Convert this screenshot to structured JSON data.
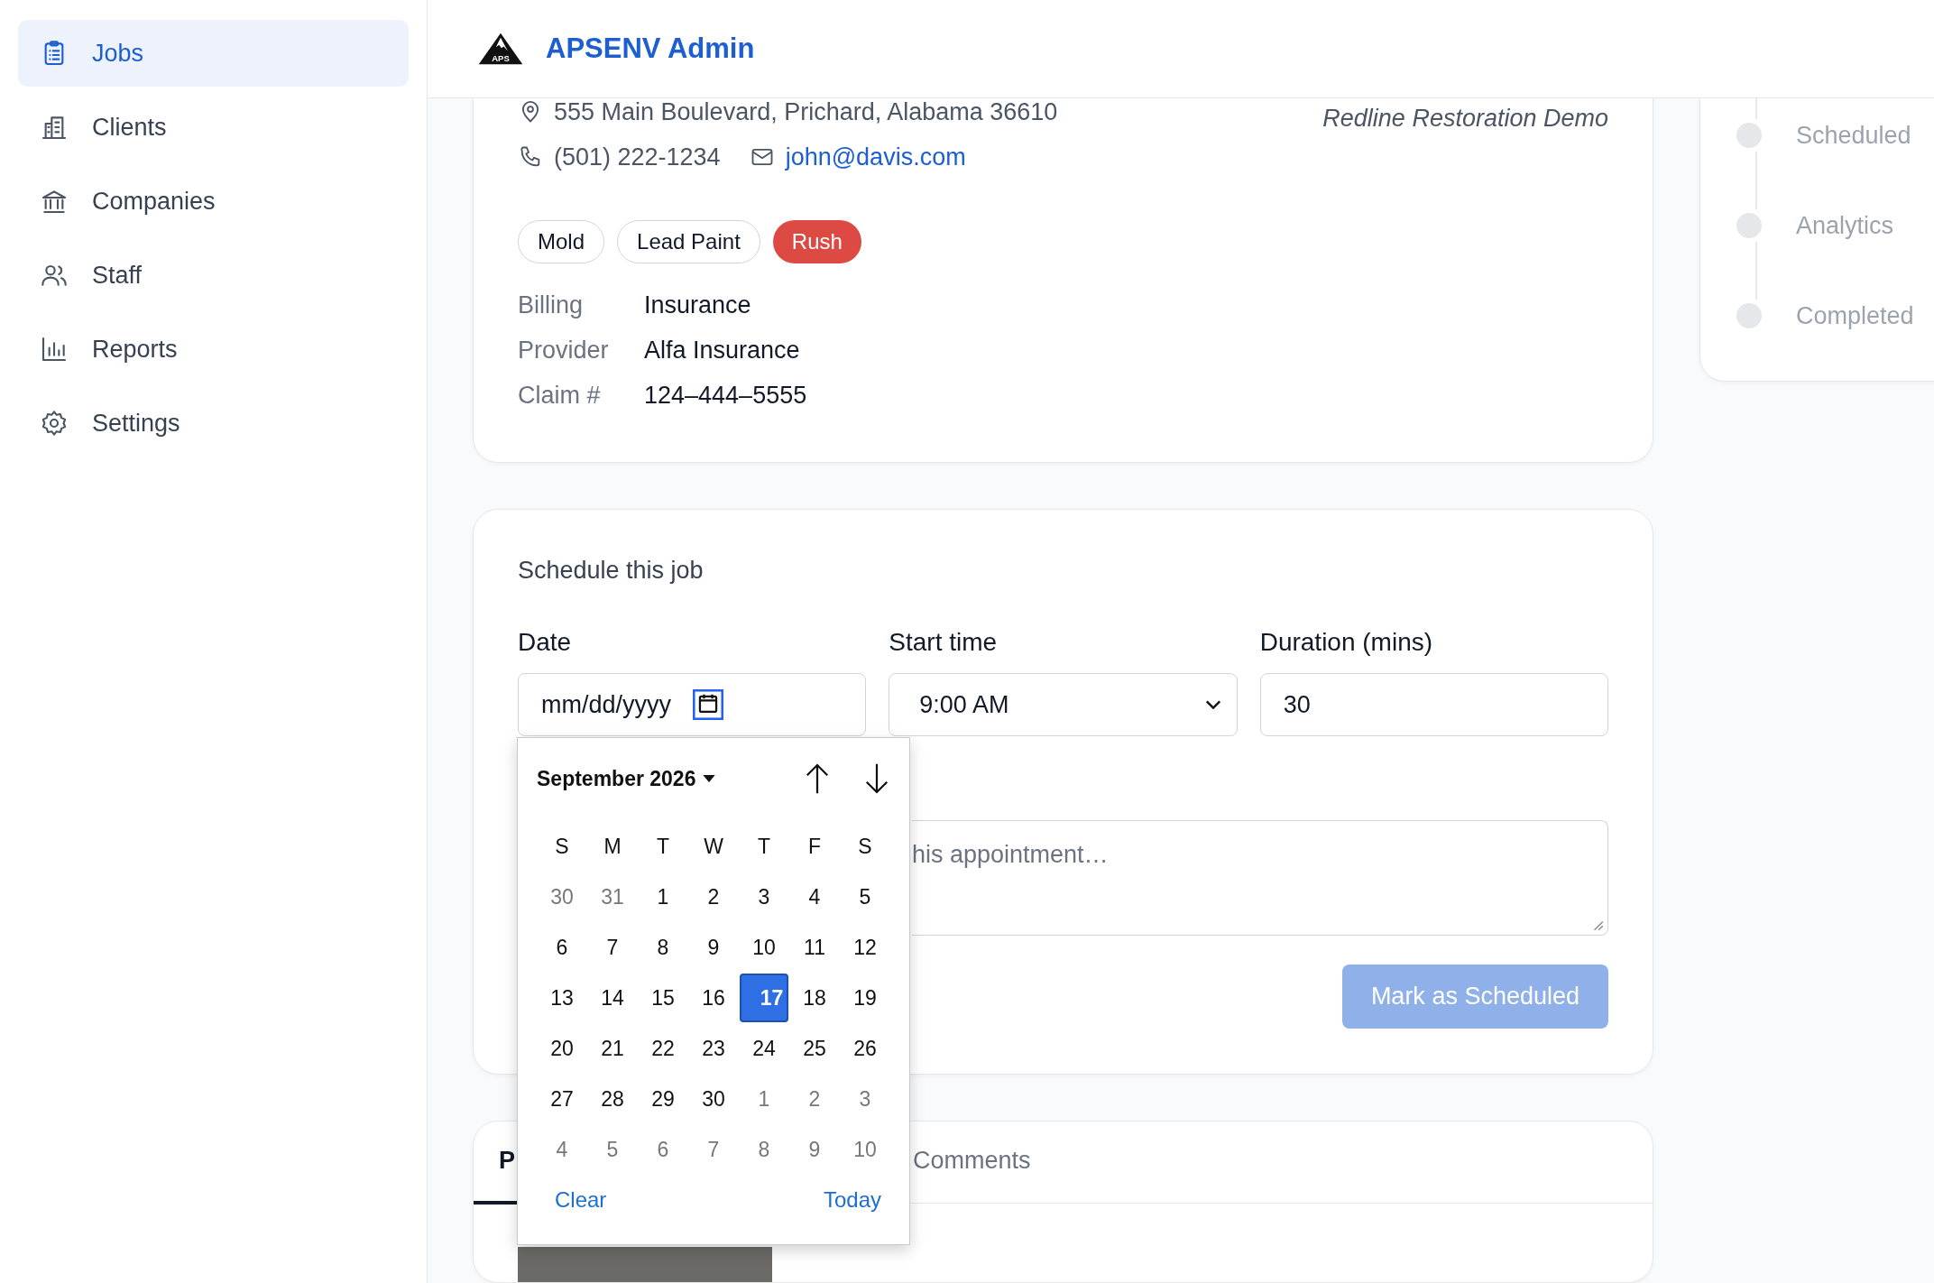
{
  "sidebar": {
    "items": [
      {
        "label": "Jobs",
        "selected": true
      },
      {
        "label": "Clients",
        "selected": false
      },
      {
        "label": "Companies",
        "selected": false
      },
      {
        "label": "Staff",
        "selected": false
      },
      {
        "label": "Reports",
        "selected": false
      },
      {
        "label": "Settings",
        "selected": false
      }
    ]
  },
  "header": {
    "logo_text": "APS",
    "title": "APSENV Admin"
  },
  "job": {
    "address": "555 Main Boulevard, Prichard, Alabama 36610",
    "phone": "(501) 222-1234",
    "email": "john@davis.com",
    "company": "Redline Restoration Demo",
    "tags": [
      {
        "label": "Mold",
        "kind": "outline"
      },
      {
        "label": "Lead Paint",
        "kind": "outline"
      },
      {
        "label": "Rush",
        "kind": "urgent"
      }
    ],
    "details": [
      {
        "label": "Billing",
        "value": "Insurance"
      },
      {
        "label": "Provider",
        "value": "Alfa Insurance"
      },
      {
        "label": "Claim #",
        "value": "124–444–5555"
      }
    ]
  },
  "schedule": {
    "title": "Schedule this job",
    "fields": [
      {
        "label": "Date",
        "kind": "date",
        "placeholder": "mm/dd/yyyy"
      },
      {
        "label": "Start time",
        "kind": "select",
        "value": "9:00 AM"
      },
      {
        "label": "Duration (mins)",
        "kind": "number",
        "value": "30"
      }
    ],
    "notes": {
      "placeholder": "his appointment…"
    },
    "submit": {
      "label": "Mark as Scheduled",
      "disabled": true
    }
  },
  "date_picker": {
    "month": "September 2026",
    "weekdays": [
      "S",
      "M",
      "T",
      "W",
      "T",
      "F",
      "S"
    ],
    "weeks": [
      [
        {
          "day": "30",
          "outside": true,
          "selected": false
        },
        {
          "day": "31",
          "outside": true,
          "selected": false
        },
        {
          "day": "1",
          "outside": false,
          "selected": false
        },
        {
          "day": "2",
          "outside": false,
          "selected": false
        },
        {
          "day": "3",
          "outside": false,
          "selected": false
        },
        {
          "day": "4",
          "outside": false,
          "selected": false
        },
        {
          "day": "5",
          "outside": false,
          "selected": false
        }
      ],
      [
        {
          "day": "6",
          "outside": false,
          "selected": false
        },
        {
          "day": "7",
          "outside": false,
          "selected": false
        },
        {
          "day": "8",
          "outside": false,
          "selected": false
        },
        {
          "day": "9",
          "outside": false,
          "selected": false
        },
        {
          "day": "10",
          "outside": false,
          "selected": false
        },
        {
          "day": "11",
          "outside": false,
          "selected": false
        },
        {
          "day": "12",
          "outside": false,
          "selected": false
        }
      ],
      [
        {
          "day": "13",
          "outside": false,
          "selected": false
        },
        {
          "day": "14",
          "outside": false,
          "selected": false
        },
        {
          "day": "15",
          "outside": false,
          "selected": false
        },
        {
          "day": "16",
          "outside": false,
          "selected": false
        },
        {
          "day": "17",
          "outside": false,
          "selected": true
        },
        {
          "day": "18",
          "outside": false,
          "selected": false
        },
        {
          "day": "19",
          "outside": false,
          "selected": false
        }
      ],
      [
        {
          "day": "20",
          "outside": false,
          "selected": false
        },
        {
          "day": "21",
          "outside": false,
          "selected": false
        },
        {
          "day": "22",
          "outside": false,
          "selected": false
        },
        {
          "day": "23",
          "outside": false,
          "selected": false
        },
        {
          "day": "24",
          "outside": false,
          "selected": false
        },
        {
          "day": "25",
          "outside": false,
          "selected": false
        },
        {
          "day": "26",
          "outside": false,
          "selected": false
        }
      ],
      [
        {
          "day": "27",
          "outside": false,
          "selected": false
        },
        {
          "day": "28",
          "outside": false,
          "selected": false
        },
        {
          "day": "29",
          "outside": false,
          "selected": false
        },
        {
          "day": "30",
          "outside": false,
          "selected": false
        },
        {
          "day": "1",
          "outside": true,
          "selected": false
        },
        {
          "day": "2",
          "outside": true,
          "selected": false
        },
        {
          "day": "3",
          "outside": true,
          "selected": false
        }
      ],
      [
        {
          "day": "4",
          "outside": true,
          "selected": false
        },
        {
          "day": "5",
          "outside": true,
          "selected": false
        },
        {
          "day": "6",
          "outside": true,
          "selected": false
        },
        {
          "day": "7",
          "outside": true,
          "selected": false
        },
        {
          "day": "8",
          "outside": true,
          "selected": false
        },
        {
          "day": "9",
          "outside": true,
          "selected": false
        },
        {
          "day": "10",
          "outside": true,
          "selected": false
        }
      ]
    ],
    "clear": "Clear",
    "today": "Today"
  },
  "tabs": [
    {
      "label": "P",
      "selected": true
    },
    {
      "label": "Comments",
      "selected": false
    }
  ],
  "status_steps": [
    {
      "label": "Scheduled",
      "done": false
    },
    {
      "label": "Analytics",
      "done": false
    },
    {
      "label": "Completed",
      "done": false
    }
  ]
}
